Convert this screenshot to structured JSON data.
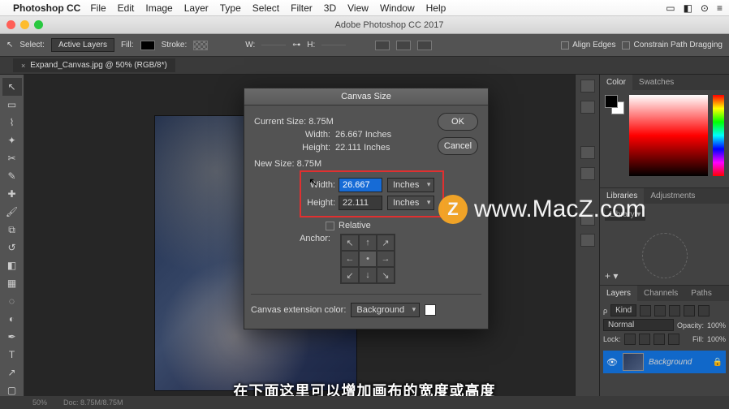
{
  "menubar": {
    "app": "Photoshop CC",
    "items": [
      "File",
      "Edit",
      "Image",
      "Layer",
      "Type",
      "Select",
      "Filter",
      "3D",
      "View",
      "Window",
      "Help"
    ]
  },
  "window": {
    "title": "Adobe Photoshop CC 2017"
  },
  "options": {
    "select_label": "Select:",
    "select_value": "Active Layers",
    "fill_label": "Fill:",
    "stroke_label": "Stroke:",
    "w_label": "W:",
    "h_label": "H:",
    "align_edges": "Align Edges",
    "constrain": "Constrain Path Dragging"
  },
  "tab": {
    "label": "Expand_Canvas.jpg @ 50% (RGB/8*)"
  },
  "dialog": {
    "title": "Canvas Size",
    "current_size_label": "Current Size: 8.75M",
    "new_size_label": "New Size: 8.75M",
    "width_label": "Width:",
    "height_label": "Height:",
    "current_width": "26.667 Inches",
    "current_height": "22.111 Inches",
    "new_width": "26.667",
    "new_height": "22.111",
    "unit": "Inches",
    "relative_label": "Relative",
    "anchor_label": "Anchor:",
    "ext_label": "Canvas extension color:",
    "ext_value": "Background",
    "ok": "OK",
    "cancel": "Cancel"
  },
  "panels": {
    "color_tab": "Color",
    "swatches_tab": "Swatches",
    "libraries_tab": "Libraries",
    "adjustments_tab": "Adjustments",
    "library_drop": "Library",
    "layers_tab": "Layers",
    "channels_tab": "Channels",
    "paths_tab": "Paths",
    "kind_label": "Kind",
    "blend_mode": "Normal",
    "opacity_label": "Opacity:",
    "opacity_value": "100%",
    "lock_label": "Lock:",
    "fill_label": "Fill:",
    "fill_value": "100%",
    "bg_layer": "Background"
  },
  "footer": {
    "zoom": "50%",
    "doc": "Doc: 8.75M/8.75M"
  },
  "subtitle": "在下面这里可以增加画布的宽度或高度",
  "watermark": "www.MacZ.com"
}
